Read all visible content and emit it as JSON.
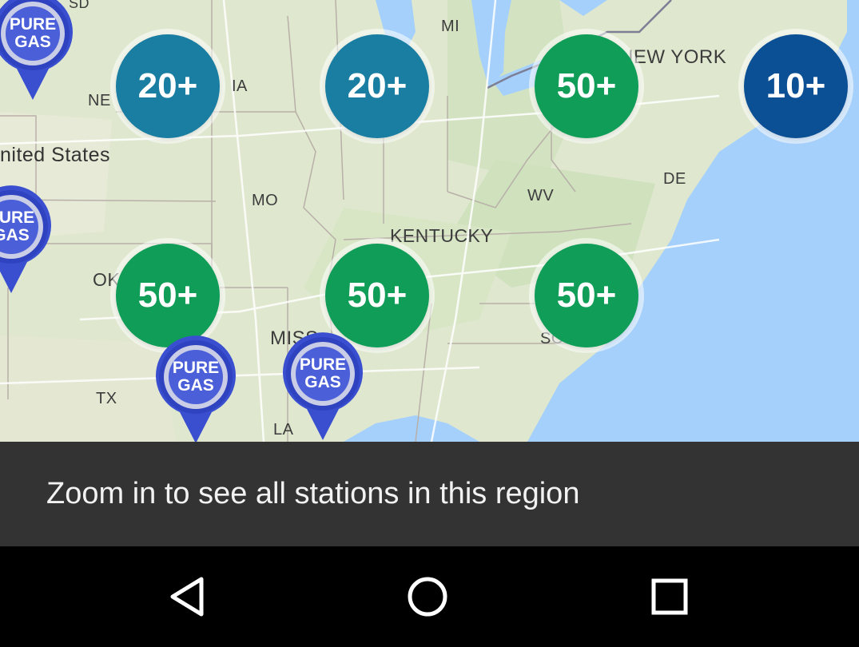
{
  "map": {
    "labels": {
      "sd": "SD",
      "mi": "MI",
      "new_york": "NEW YORK",
      "ne": "NE",
      "ia": "IA",
      "united_states": "nited States",
      "de": "DE",
      "mo": "MO",
      "wv": "WV",
      "kentucky": "KENTUCKY",
      "ok": "OK",
      "miss": "MISS",
      "so": "SO",
      "tx": "TX",
      "la": "LA"
    },
    "clusters": [
      {
        "count": "20+",
        "color": "#1a7ea3"
      },
      {
        "count": "20+",
        "color": "#1a7ea3"
      },
      {
        "count": "50+",
        "color": "#0f9d58"
      },
      {
        "count": "10+",
        "color": "#0b4f94"
      },
      {
        "count": "50+",
        "color": "#0f9d58"
      },
      {
        "count": "50+",
        "color": "#0f9d58"
      },
      {
        "count": "50+",
        "color": "#0f9d58"
      }
    ],
    "pin_brand": {
      "line1": "PURE",
      "line2": "GAS",
      "color": "#3a4fd0"
    },
    "colors": {
      "land": "#dfe8cf",
      "water": "#a5d0fb",
      "roads": "#ffffff"
    }
  },
  "toast": {
    "message": "Zoom in to see all stations in this region",
    "background": "#333333"
  },
  "navbar": {
    "back": "back-icon",
    "home": "home-icon",
    "recents": "recents-icon"
  }
}
